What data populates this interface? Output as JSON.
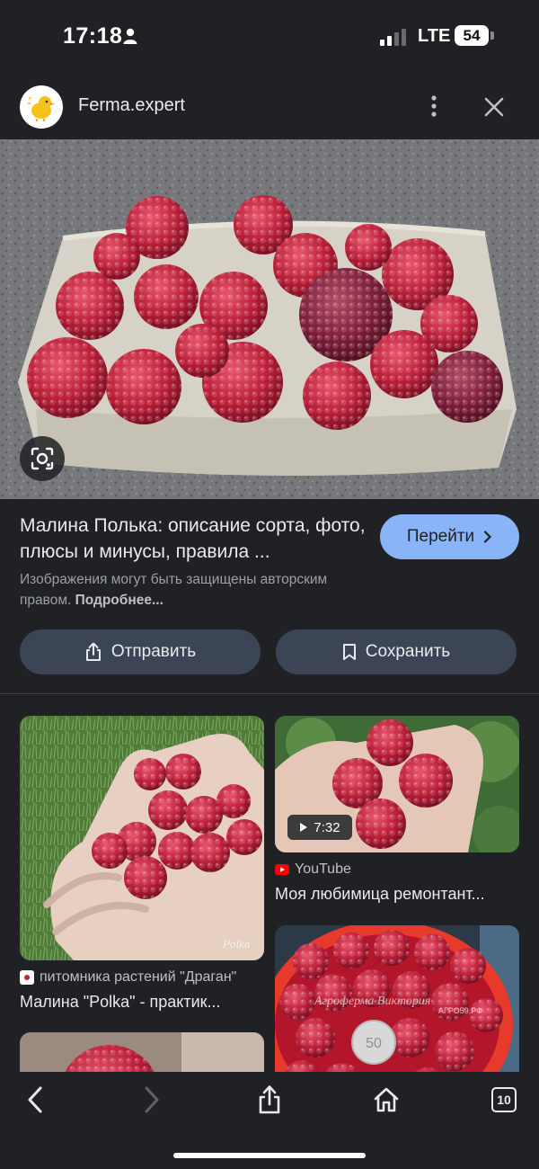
{
  "status": {
    "time": "17:18",
    "network": "LTE",
    "battery": "54"
  },
  "header": {
    "site": "Ferma.expert",
    "logo_icon": "chick-icon"
  },
  "info": {
    "title": "Малина Полька: описание сорта, фото, плюсы и минусы, правила ...",
    "visit_label": "Перейти",
    "copyright": "Изображения могут быть защищены авторским правом.",
    "learn_more": "Подробнее..."
  },
  "actions": {
    "share_label": "Отправить",
    "save_label": "Сохранить"
  },
  "results": [
    {
      "source": "питомника растений \"Драган\"",
      "title": "Малина \"Polka\" - практик..."
    },
    {
      "source": "YouTube",
      "title": "Моя любимица ремонтант...",
      "duration": "7:32"
    }
  ],
  "watermarks": {
    "result1": "Polka",
    "result3": "Агроферма Виктория",
    "result3_site": "АГРО59.РФ",
    "coin": "50"
  },
  "bottom": {
    "tab_count": "10"
  },
  "colors": {
    "background": "#202124",
    "accent": "#8ab4f8",
    "button": "#3c4556"
  }
}
